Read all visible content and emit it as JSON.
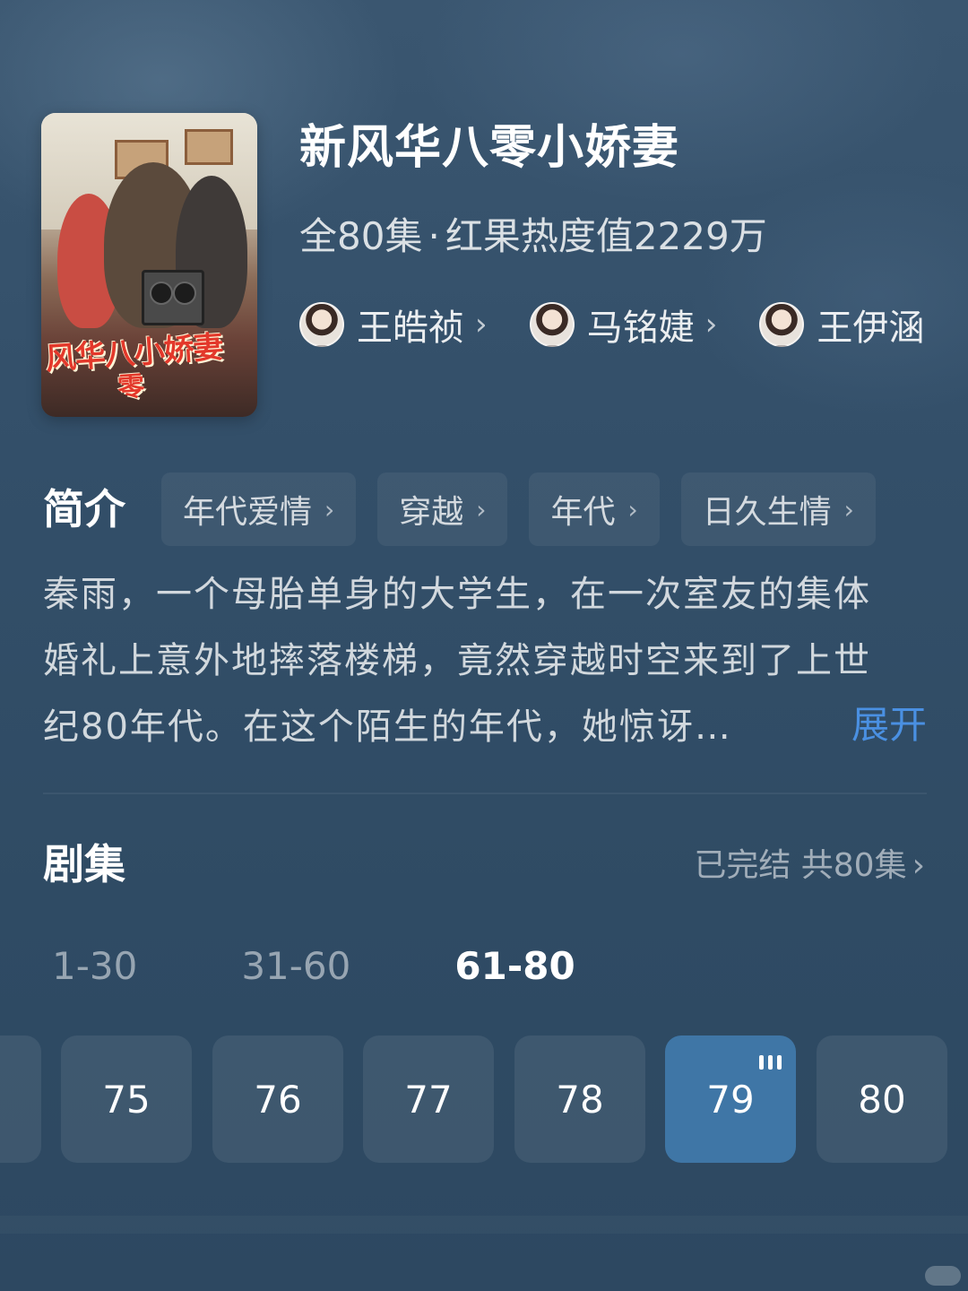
{
  "show": {
    "title": "新风华八零小娇妻",
    "episode_count_text": "全80集",
    "dot": "·",
    "heat_text": "红果热度值2229万",
    "poster_title_art": "风华八小娇妻",
    "poster_title_sub": "零"
  },
  "cast": [
    {
      "name": "王皓祯",
      "chevron": "›"
    },
    {
      "name": "马铭婕",
      "chevron": "›"
    },
    {
      "name": "王伊涵",
      "chevron": "›"
    }
  ],
  "intro": {
    "heading": "简介",
    "tags": [
      {
        "label": "年代爱情",
        "chevron": "›"
      },
      {
        "label": "穿越",
        "chevron": "›"
      },
      {
        "label": "年代",
        "chevron": "›"
      },
      {
        "label": "日久生情",
        "chevron": "›"
      }
    ],
    "synopsis_lines": [
      "秦雨，一个母胎单身的大学生，在一次室友的集体",
      "婚礼上意外地摔落楼梯，竟然穿越时空来到了上世",
      "纪80年代。在这个陌生的年代，她惊讶…"
    ],
    "expand_label": "展开"
  },
  "episodes": {
    "heading": "剧集",
    "status": "已完结 共80集",
    "status_chevron": "›",
    "ranges": [
      "1-30",
      "31-60",
      "61-80"
    ],
    "active_range": "61-80",
    "items": [
      "75",
      "76",
      "77",
      "78",
      "79",
      "80"
    ],
    "current": "79"
  },
  "colors": {
    "background": "#2e4a63",
    "accent_link": "#4a90e2",
    "current_episode": "#3f76a6"
  }
}
